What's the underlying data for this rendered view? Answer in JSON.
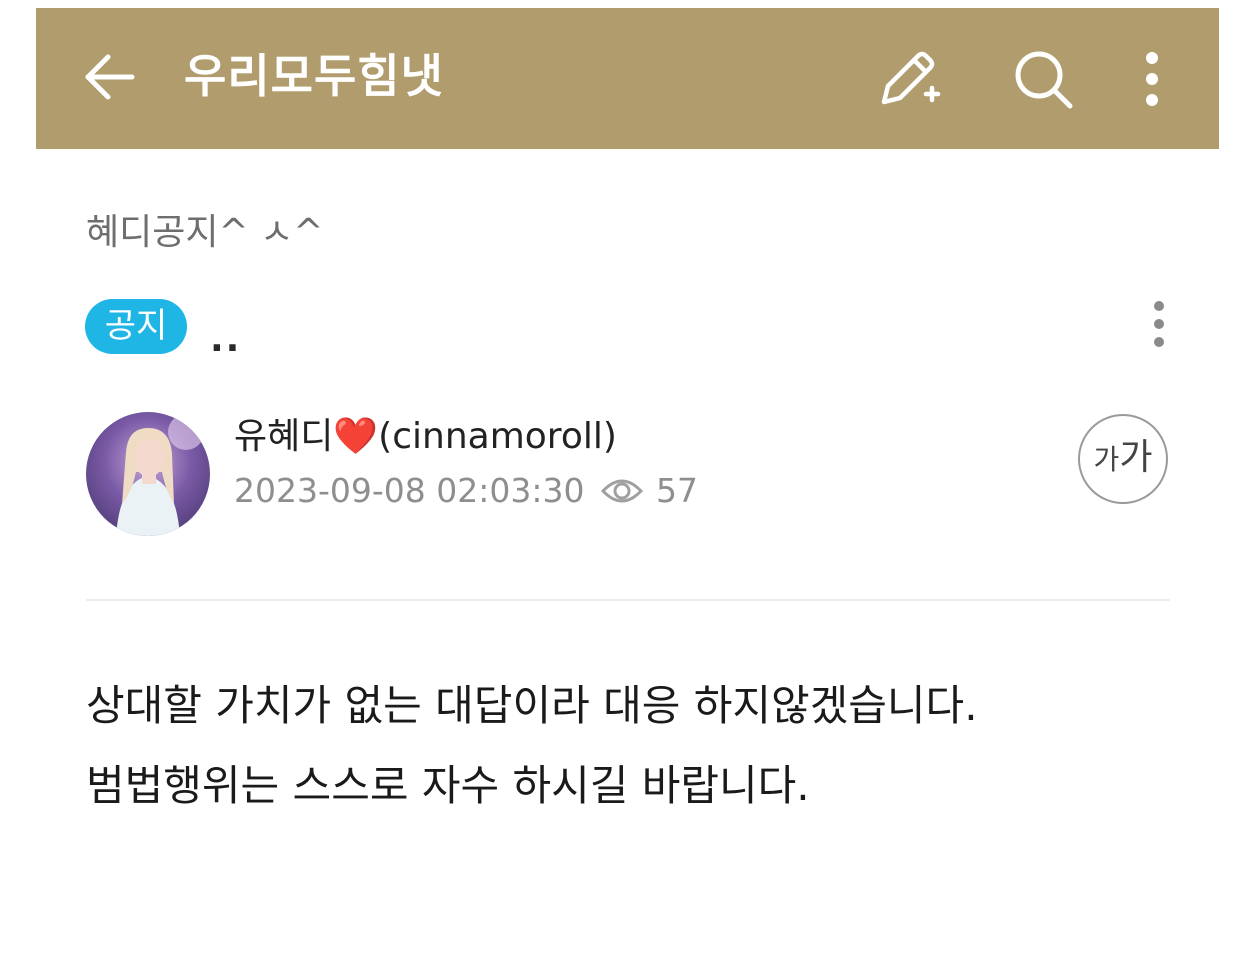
{
  "app_bar": {
    "title": "우리모두힘냇",
    "background_color": "#b09c6c",
    "icons": [
      "back-arrow-icon",
      "write-post-icon",
      "search-icon",
      "more-vertical-icon"
    ]
  },
  "post": {
    "board_name": "혜디공지^ ㅅ^",
    "badge": "공지",
    "badge_color": "#1fb6e6",
    "title": "..",
    "author": "유혜디❤️(cinnamoroll)",
    "date": "2023-09-08 02:03:30",
    "views": "57",
    "font_size_button": {
      "small": "가",
      "large": "가"
    },
    "body": [
      "상대할 가치가 없는 대답이라 대응 하지않겠습니다.",
      "범법행위는 스스로 자수 하시길 바랍니다."
    ]
  }
}
